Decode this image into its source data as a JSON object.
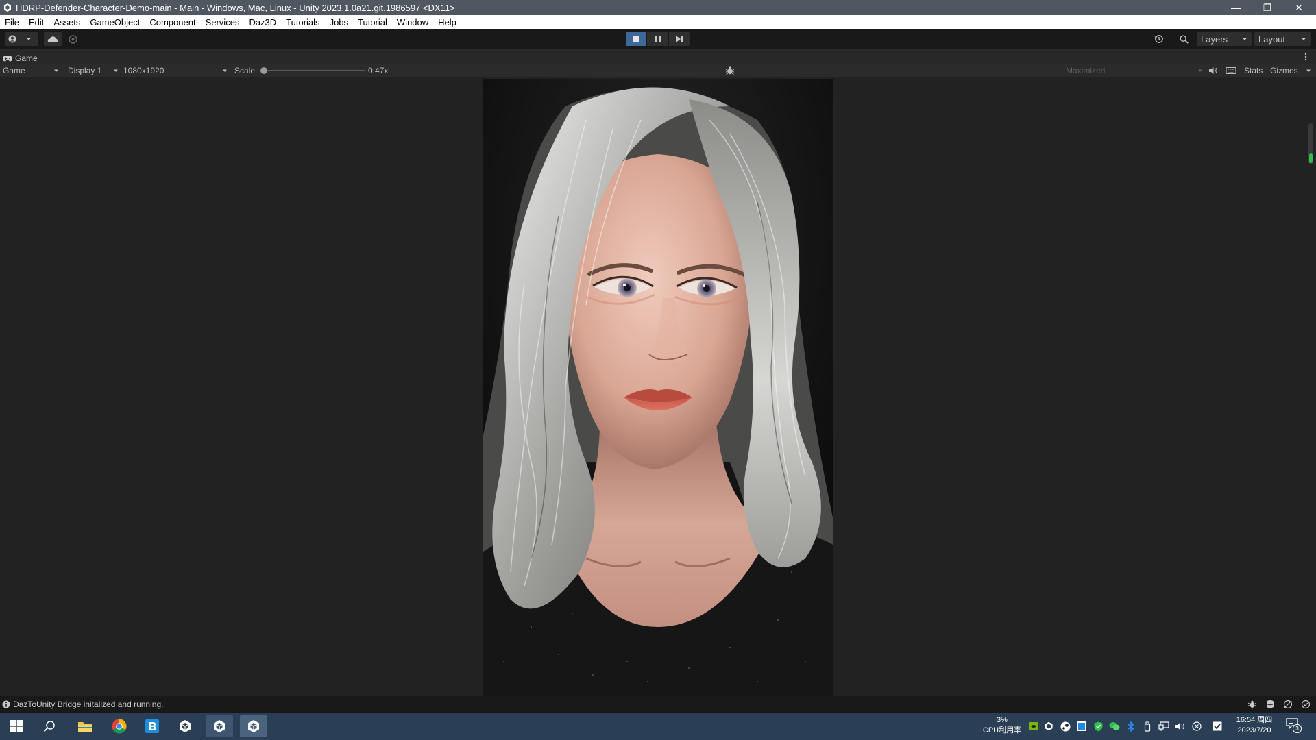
{
  "window": {
    "title": "HDRP-Defender-Character-Demo-main - Main - Windows, Mac, Linux - Unity 2023.1.0a21.git.1986597 <DX11>",
    "minimize_glyph": "—",
    "restore_glyph": "❐",
    "close_glyph": "✕"
  },
  "menu": [
    "File",
    "Edit",
    "Assets",
    "GameObject",
    "Component",
    "Services",
    "Daz3D",
    "Tutorials",
    "Jobs",
    "Tutorial",
    "Window",
    "Help"
  ],
  "toolbar": {
    "layers_label": "Layers",
    "layout_label": "Layout"
  },
  "game_view": {
    "tab_label": "Game",
    "mode_value": "Game",
    "display_value": "Display 1",
    "resolution_value": "1080x1920",
    "scale_label": "Scale",
    "scale_value": "0.47x",
    "scale_fraction": 0.0,
    "maximized_value": "Maximized",
    "stats_label": "Stats",
    "gizmos_label": "Gizmos"
  },
  "status": {
    "message": "DazToUnity Bridge initalized and running."
  },
  "taskbar": {
    "cpu_percent": "3%",
    "cpu_label": "CPU利用率",
    "time": "16:54 周四",
    "date": "2023/7/20",
    "notification_count": "3"
  },
  "colors": {
    "title_bar": "#4f5861",
    "play_active": "#3d6a9a",
    "taskbar": "#2a3f55",
    "editor_bg": "#282828"
  }
}
